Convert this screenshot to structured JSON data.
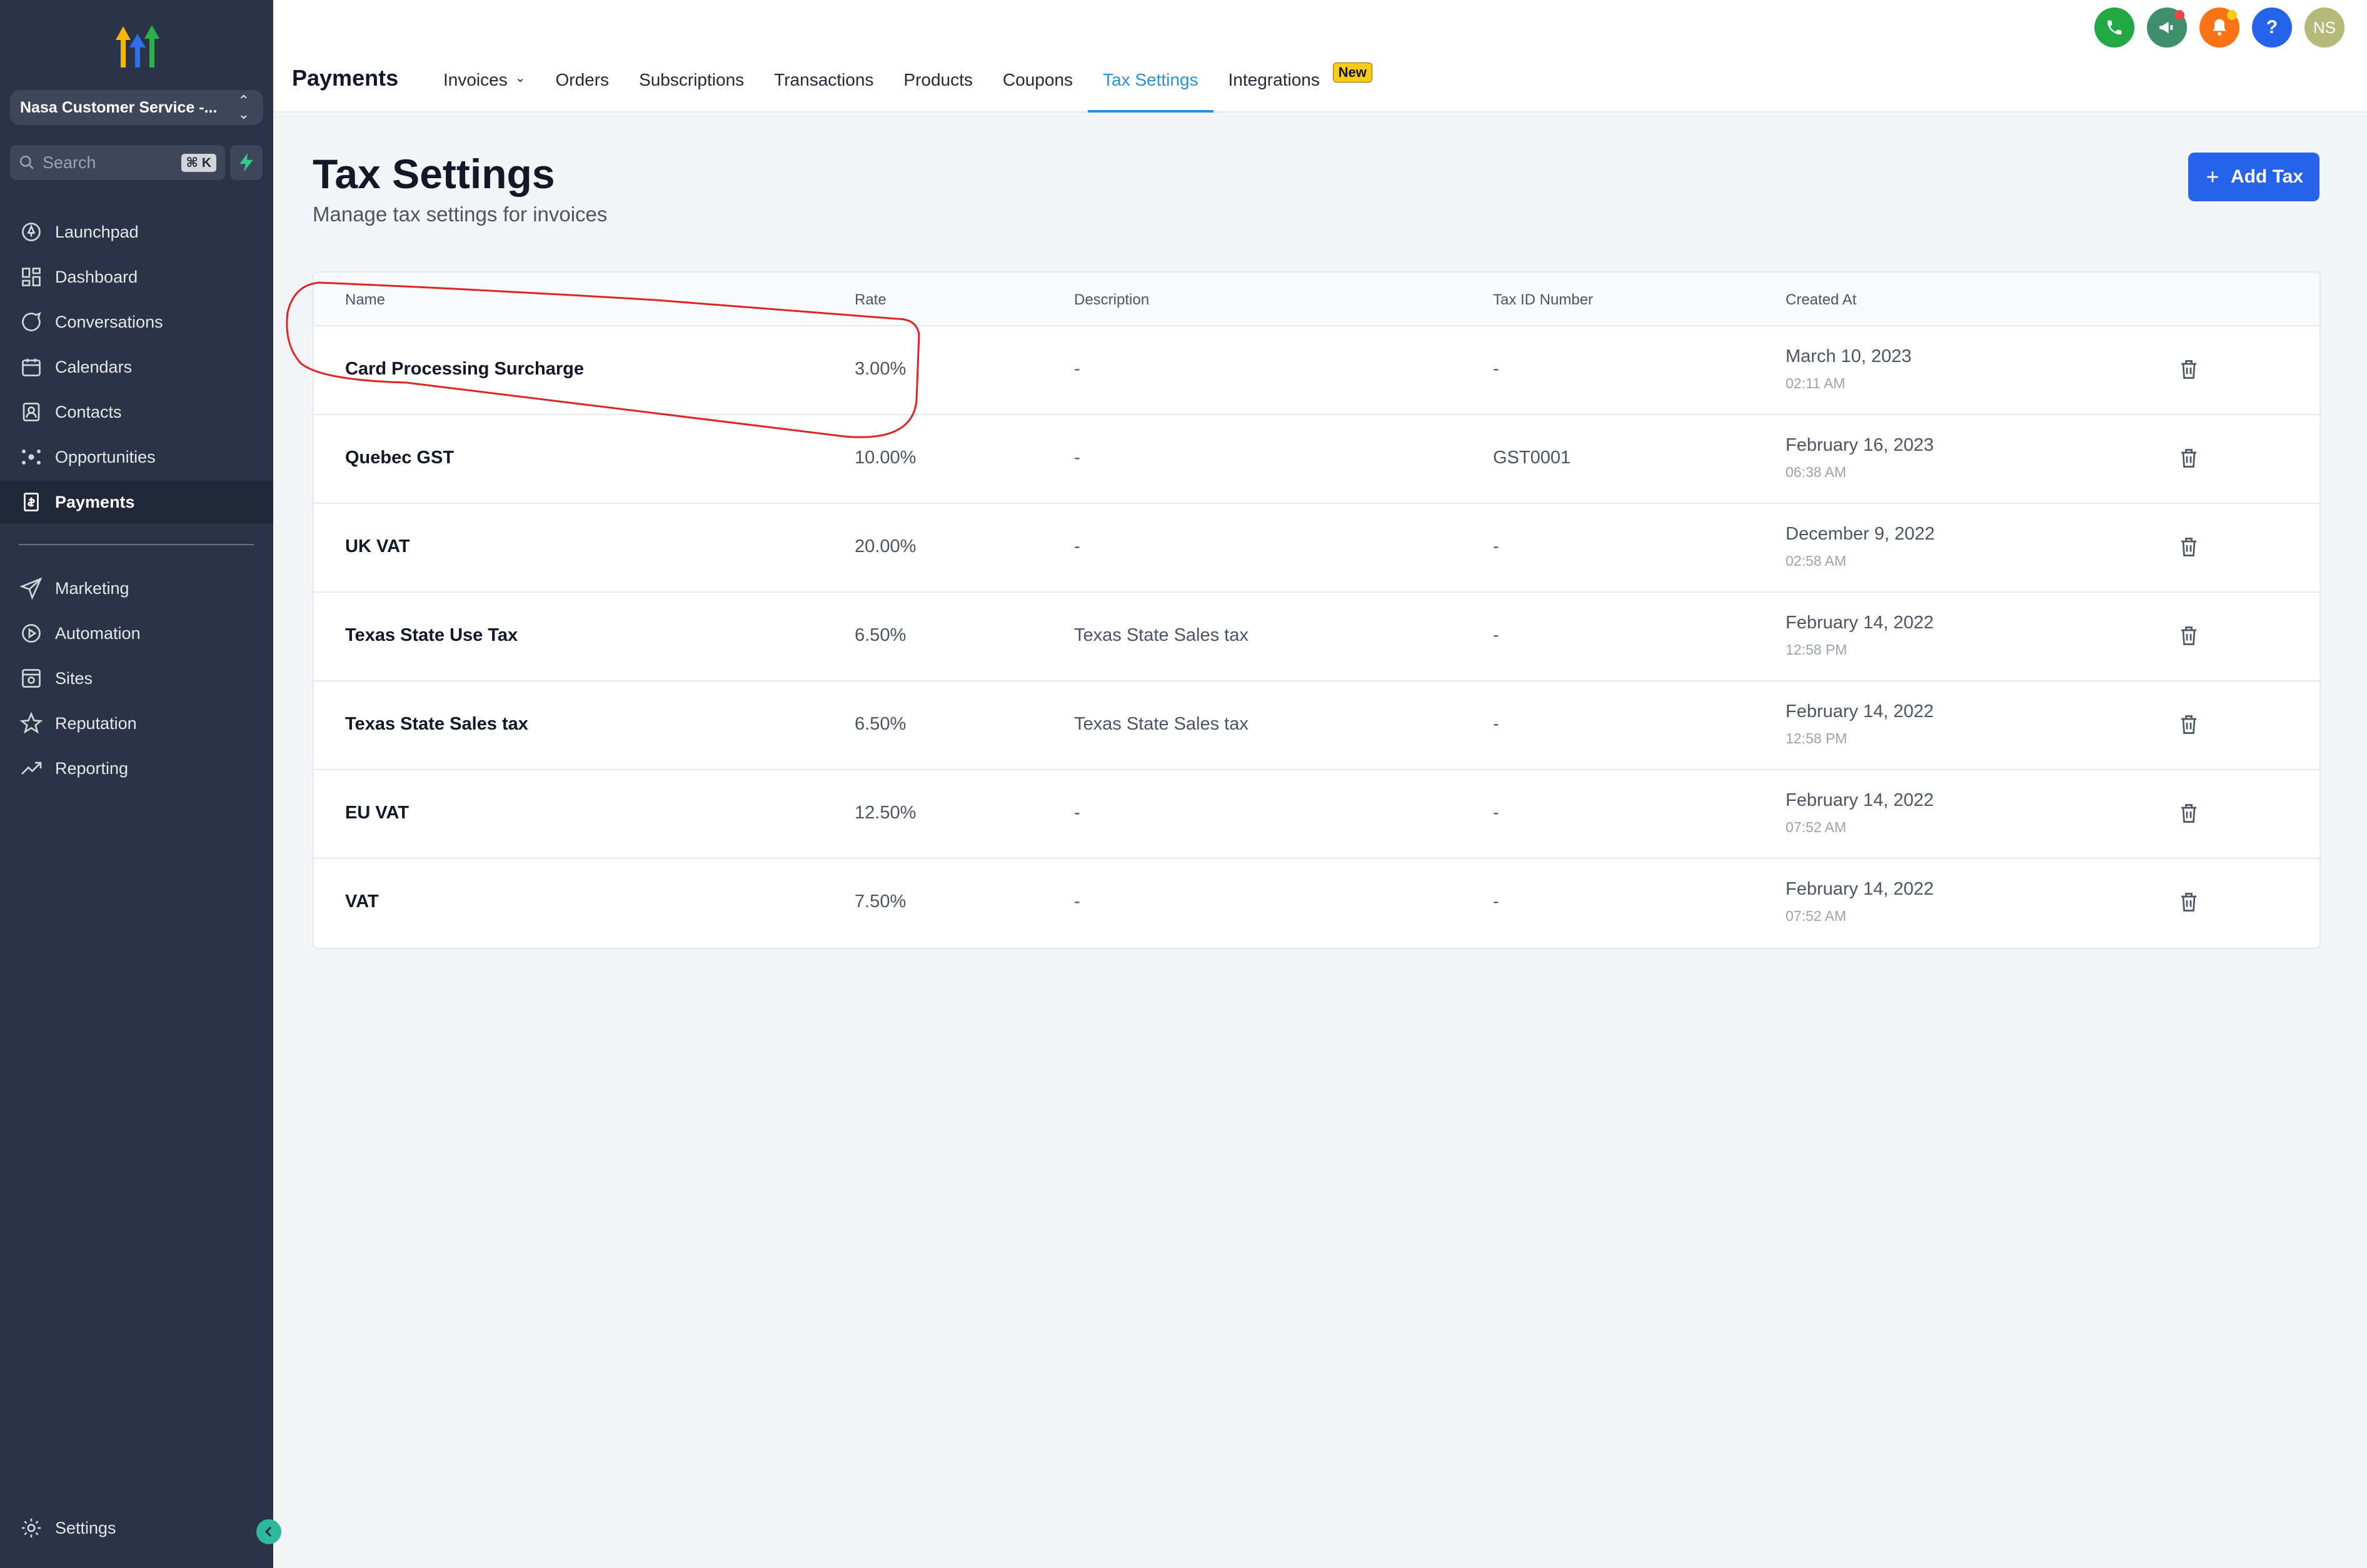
{
  "sidebar": {
    "account": "Nasa Customer Service -...",
    "search_placeholder": "Search",
    "search_shortcut": "⌘ K",
    "items": [
      {
        "label": "Launchpad",
        "icon": "rocket-icon"
      },
      {
        "label": "Dashboard",
        "icon": "grid-icon"
      },
      {
        "label": "Conversations",
        "icon": "chat-icon"
      },
      {
        "label": "Calendars",
        "icon": "calendar-icon"
      },
      {
        "label": "Contacts",
        "icon": "contacts-icon"
      },
      {
        "label": "Opportunities",
        "icon": "network-icon"
      },
      {
        "label": "Payments",
        "icon": "receipt-icon",
        "active": true
      },
      {
        "label": "Marketing",
        "icon": "send-icon"
      },
      {
        "label": "Automation",
        "icon": "automation-icon"
      },
      {
        "label": "Sites",
        "icon": "sites-icon"
      },
      {
        "label": "Reputation",
        "icon": "star-icon"
      },
      {
        "label": "Reporting",
        "icon": "trend-icon"
      }
    ],
    "settings_label": "Settings"
  },
  "header": {
    "section": "Payments",
    "tabs": [
      {
        "label": "Invoices",
        "has_dropdown": true
      },
      {
        "label": "Orders"
      },
      {
        "label": "Subscriptions"
      },
      {
        "label": "Transactions"
      },
      {
        "label": "Products"
      },
      {
        "label": "Coupons"
      },
      {
        "label": "Tax Settings",
        "active": true
      },
      {
        "label": "Integrations",
        "badge": "New"
      }
    ],
    "avatar_initials": "NS",
    "help_glyph": "?",
    "colors": {
      "phone": "#22a845",
      "megaphone": "#3f8f6f",
      "bell": "#f97316",
      "help": "#2563eb",
      "avatar": "#b5b97a"
    }
  },
  "main": {
    "title": "Tax Settings",
    "subtitle": "Manage tax settings for invoices",
    "add_button": "Add Tax",
    "table": {
      "columns": [
        "Name",
        "Rate",
        "Description",
        "Tax ID Number",
        "Created At"
      ],
      "rows": [
        {
          "name": "Card Processing Surcharge",
          "rate": "3.00%",
          "description": "-",
          "tax_id": "-",
          "date": "March 10, 2023",
          "time": "02:11 AM"
        },
        {
          "name": "Quebec GST",
          "rate": "10.00%",
          "description": "-",
          "tax_id": "GST0001",
          "date": "February 16, 2023",
          "time": "06:38 AM"
        },
        {
          "name": "UK VAT",
          "rate": "20.00%",
          "description": "-",
          "tax_id": "-",
          "date": "December 9, 2022",
          "time": "02:58 AM"
        },
        {
          "name": "Texas State Use Tax",
          "rate": "6.50%",
          "description": "Texas State Sales tax",
          "tax_id": "-",
          "date": "February 14, 2022",
          "time": "12:58 PM"
        },
        {
          "name": "Texas State Sales tax",
          "rate": "6.50%",
          "description": "Texas State Sales tax",
          "tax_id": "-",
          "date": "February 14, 2022",
          "time": "12:58 PM"
        },
        {
          "name": "EU VAT",
          "rate": "12.50%",
          "description": "-",
          "tax_id": "-",
          "date": "February 14, 2022",
          "time": "07:52 AM"
        },
        {
          "name": "VAT",
          "rate": "7.50%",
          "description": "-",
          "tax_id": "-",
          "date": "February 14, 2022",
          "time": "07:52 AM"
        }
      ]
    }
  },
  "annotation_color": "#dc2626"
}
